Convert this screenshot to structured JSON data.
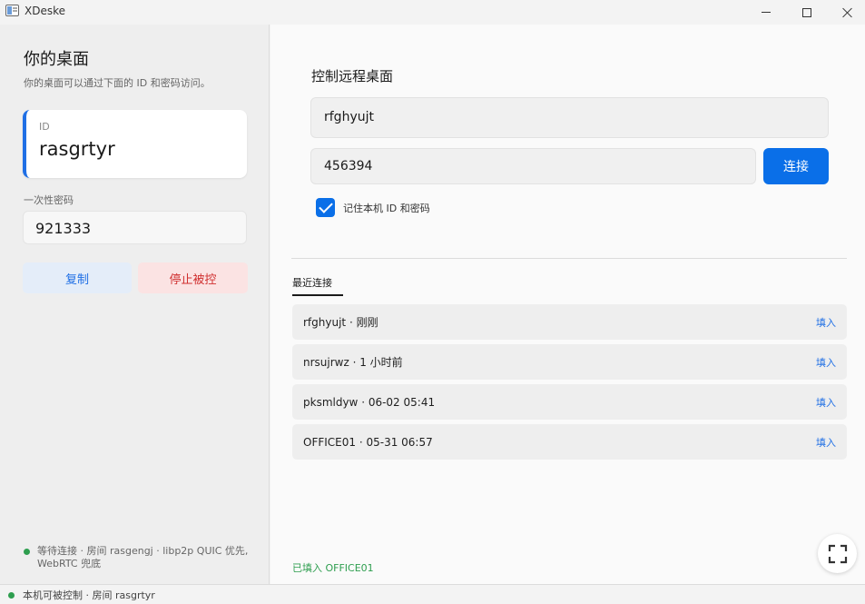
{
  "window": {
    "title": "XDeske",
    "icon": "app-window-icon"
  },
  "sidebar": {
    "title": "你的桌面",
    "subtitle": "你的桌面可以通过下面的 ID 和密码访问。",
    "id_label": "ID",
    "id_value": "rasgrtyr",
    "password_label": "一次性密码",
    "password_value": "921333",
    "copy_label": "复制",
    "stop_label": "停止被控",
    "status_text": "等待连接 · 房间 rasgengj · libp2p QUIC 优先, WebRTC 兜底"
  },
  "main": {
    "title": "控制远程桌面",
    "remote_id_value": "rfghyujt",
    "password_value": "456394",
    "connect_label": "连接",
    "remember_label": "记住本机 ID 和密码",
    "remember_checked": true,
    "recent_tab_label": "最近连接",
    "recent": [
      {
        "text": "rfghyujt · 刚刚",
        "action": "填入"
      },
      {
        "text": "nrsujrwz · 1 小时前",
        "action": "填入"
      },
      {
        "text": "pksmldyw · 06-02 05:41",
        "action": "填入"
      },
      {
        "text": "OFFICE01 · 05-31 06:57",
        "action": "填入"
      }
    ],
    "filled_status": "已填入 OFFICE01"
  },
  "statusbar": {
    "text": "本机可被控制 · 房间 rasgrtyr"
  },
  "colors": {
    "accent": "#0a6fe8",
    "danger": "#d03030",
    "success": "#2e9e4f"
  }
}
